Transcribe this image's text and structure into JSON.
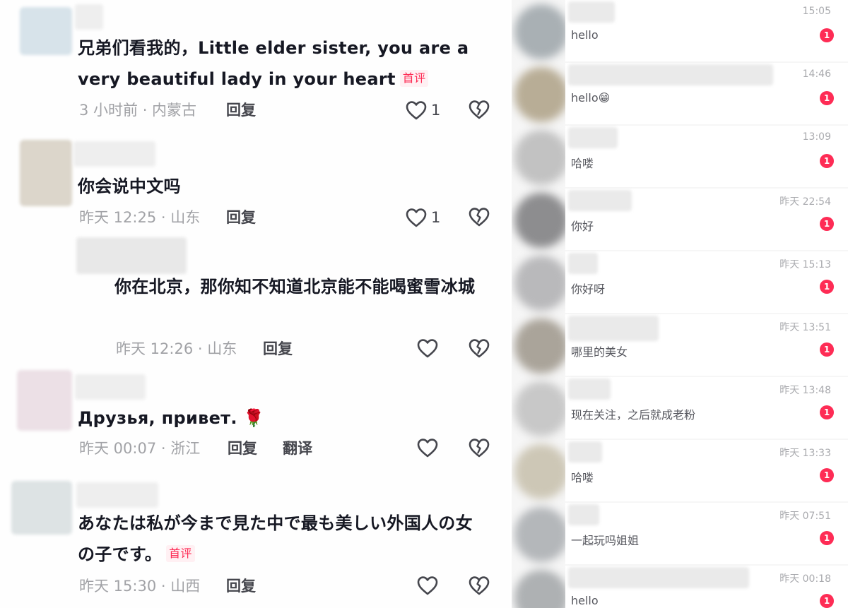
{
  "colors": {
    "accent": "#fe2c55",
    "text": "#161823",
    "meta": "#a1a2a6"
  },
  "comments": [
    {
      "text": "兄弟们看我的，Little elder sister, you are a very beautiful lady in your heart",
      "tag": "首评",
      "meta": "3 小时前 · 内蒙古",
      "reply": "回复",
      "likes": "1",
      "avatar_color": "#d7e3ea"
    },
    {
      "text": "你会说中文吗",
      "meta": "昨天 12:25 · 山东",
      "reply": "回复",
      "likes": "1",
      "avatar_color": "#dcd6cb"
    },
    {
      "text": "你在北京，那你知不知道北京能不能喝蜜雪冰城",
      "meta": "昨天 12:26 · 山东",
      "reply": "回复",
      "avatar_color": "#e3e3e3"
    },
    {
      "text": "Друзья, привет. 🌹",
      "meta": "昨天 00:07 · 浙江",
      "reply": "回复",
      "translate": "翻译",
      "avatar_color": "#ece0e6"
    },
    {
      "text": "あなたは私が今まで見た中で最も美しい外国人の女の子です。",
      "tag": "首评",
      "meta": "昨天 15:30 · 山西",
      "reply": "回复",
      "avatar_color": "#dde3e4"
    }
  ],
  "messages": [
    {
      "time": "15:05",
      "text": "hello",
      "badge": "1",
      "avatar_color": "#a9b0b4"
    },
    {
      "time": "14:46",
      "text": "hello😁",
      "badge": "1",
      "avatar_color": "#b8ad96"
    },
    {
      "time": "13:09",
      "text": "哈喽",
      "badge": "1",
      "avatar_color": "#c2c2c2"
    },
    {
      "time": "昨天 22:54",
      "text": "你好",
      "badge": "1",
      "avatar_color": "#8d8d8f"
    },
    {
      "time": "昨天 15:13",
      "text": "你好呀",
      "badge": "1",
      "avatar_color": "#b9b9bb"
    },
    {
      "time": "昨天 13:51",
      "text": "哪里的美女",
      "badge": "1",
      "avatar_color": "#aaa49a"
    },
    {
      "time": "昨天 13:48",
      "text": "现在关注，之后就成老粉",
      "badge": "1",
      "avatar_color": "#c8c8c8"
    },
    {
      "time": "昨天 13:33",
      "text": "哈喽",
      "badge": "1",
      "avatar_color": "#cdc7b6"
    },
    {
      "time": "昨天 07:51",
      "text": "一起玩吗姐姐",
      "badge": "1",
      "avatar_color": "#b4b7ba"
    },
    {
      "time": "昨天 00:18",
      "text": "hello",
      "badge": "1",
      "avatar_color": "#aeb1b3"
    }
  ]
}
